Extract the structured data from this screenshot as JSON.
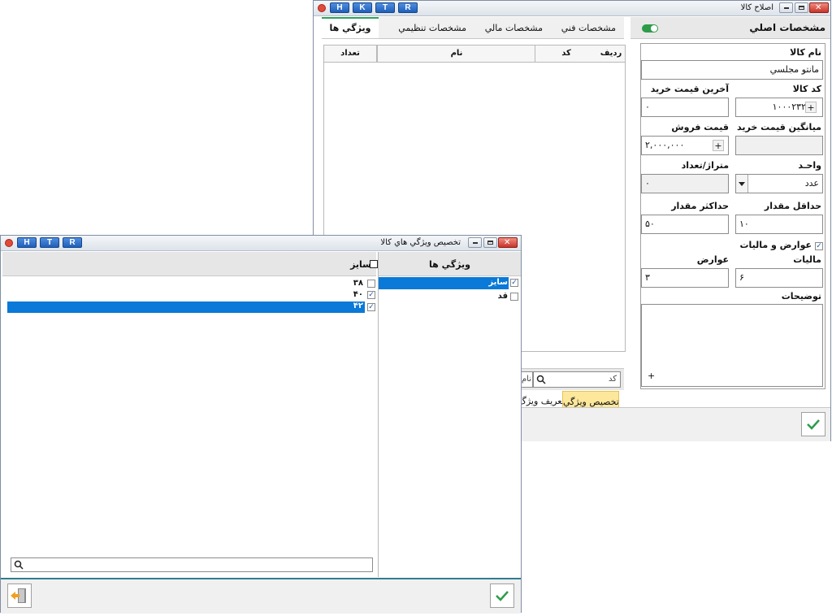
{
  "colors": {
    "accent": "#0a79d8",
    "ok_green": "#2d9c4a",
    "tab_highlight": "#fde79b",
    "title_buttons": "#1f5fb8"
  },
  "window_main": {
    "title": "اصلاح کالا",
    "title_buttons": [
      "H",
      "K",
      "T",
      "R"
    ],
    "main_panel": {
      "title": "مشخصات اصلي",
      "fields": {
        "name_label": "نام کالا",
        "name_value": "مانتو مجلسي",
        "code_label": "کد کالا",
        "code_value": "۱۰۰۰۲۳۲",
        "last_price_label": "آخرين قيمت خريد",
        "last_price_value": "۰",
        "avg_price_label": "ميانگين قيمت خريد",
        "avg_price_value": "",
        "sale_price_label": "قيمت فروش",
        "sale_price_value": "۲,۰۰۰,۰۰۰",
        "unit_label": "واحـد",
        "unit_value": "عدد",
        "meter_label": "متراژ/تعداد",
        "meter_value": "۰",
        "min_label": "حداقل مقدار",
        "min_value": "۱۰",
        "max_label": "حداکثر مقدار",
        "max_value": "۵۰",
        "tax_checkbox_label": "عوارض و ماليات",
        "tax_label": "ماليات",
        "tax_value": "۶",
        "duty_label": "عوارض",
        "duty_value": "۳",
        "desc_label": "توضيحات",
        "plus_glyph": "+"
      }
    },
    "tabs": [
      "مشخصات فني",
      "مشخصات مالي",
      "مشخصات تنظيمي",
      "ويژگي ها"
    ],
    "grid_columns": [
      "رديف",
      "کد",
      "نام",
      "تعداد"
    ],
    "search": {
      "code_placeholder": "کد",
      "name_placeholder": "نام"
    },
    "bottom_tabs": [
      "تخصيص ويژگي",
      "تعريف ويژگ"
    ]
  },
  "window_assign": {
    "title": "تخصيص ويژگي  هاي کالا",
    "title_buttons": [
      "H",
      "T",
      "R"
    ],
    "features_header": "ويژگي ها",
    "features": [
      {
        "label": "سايز",
        "checked": true,
        "selected": true
      },
      {
        "label": "قد",
        "checked": false,
        "selected": false
      }
    ],
    "values_header": "سايز",
    "values": [
      {
        "label": "۳۸",
        "checked": false,
        "selected": false
      },
      {
        "label": "۴۰",
        "checked": true,
        "selected": false
      },
      {
        "label": "۴۲",
        "checked": true,
        "selected": true
      }
    ],
    "search_placeholder": ""
  }
}
